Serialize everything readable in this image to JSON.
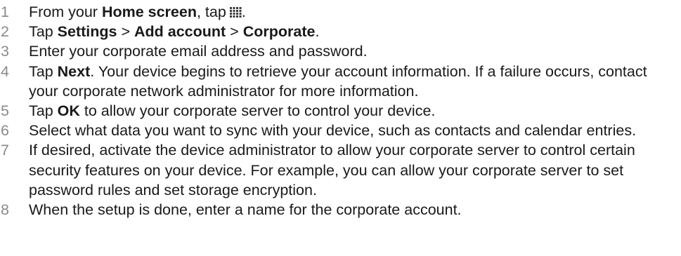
{
  "steps": [
    {
      "number": "1",
      "text_a": "From your ",
      "bold_a": "Home screen",
      "text_b": ", tap",
      "icon": "apps-grid-icon",
      "text_c": "."
    },
    {
      "number": "2",
      "text_a": "Tap ",
      "bold_a": "Settings",
      "sep_1": " > ",
      "bold_b": "Add account",
      "sep_2": " > ",
      "bold_c": "Corporate",
      "text_b": "."
    },
    {
      "number": "3",
      "text": "Enter your corporate email address and password."
    },
    {
      "number": "4",
      "text_a": "Tap ",
      "bold_a": "Next",
      "text_b": ". Your device begins to retrieve your account information. If a failure occurs, contact your corporate network administrator for more information."
    },
    {
      "number": "5",
      "text_a": "Tap ",
      "bold_a": "OK",
      "text_b": " to allow your corporate server to control your device."
    },
    {
      "number": "6",
      "text": "Select what data you want to sync with your device, such as contacts and calendar entries."
    },
    {
      "number": "7",
      "text": "If desired, activate the device administrator to allow your corporate server to control certain security features on your device. For example, you can allow your corporate server to set password rules and set storage encryption."
    },
    {
      "number": "8",
      "text": "When the setup is done, enter a name for the corporate account."
    }
  ],
  "colors": {
    "step_number": "#8a8a8a",
    "body_text": "#1a1a1a"
  }
}
